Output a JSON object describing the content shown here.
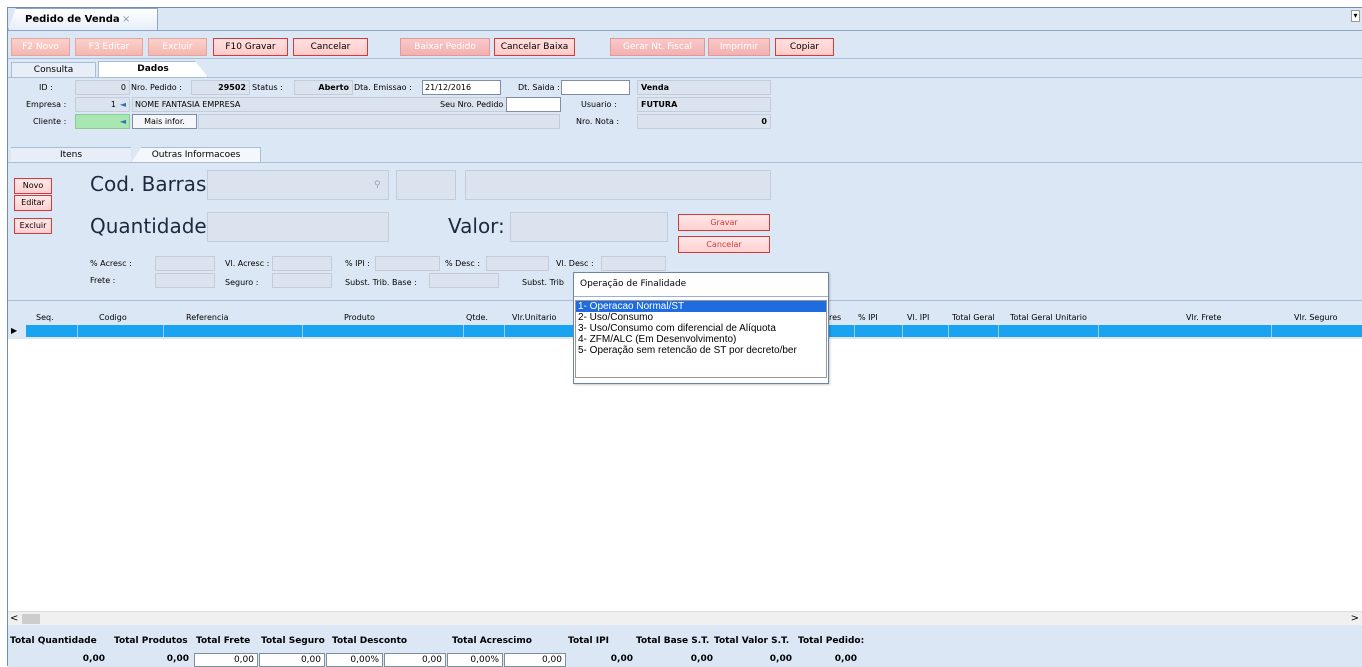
{
  "window": {
    "tab_title": "Pedido de Venda",
    "close_glyph": "×",
    "dropdown_glyph": "▾"
  },
  "toolbar": {
    "novo": "F2 Novo",
    "editar": "F3 Editar",
    "excluir": "Excluir",
    "gravar": "F10 Gravar",
    "cancelar": "Cancelar",
    "baixar": "Baixar Pedido",
    "cancelar_baixa": "Cancelar Baixa",
    "gerar_nf": "Gerar Nt. Fiscal",
    "imprimir": "Imprimir",
    "copiar": "Copiar"
  },
  "tabs": {
    "consulta": "Consulta",
    "dados": "Dados",
    "itens": "Itens",
    "outras": "Outras Informacoes"
  },
  "header": {
    "id_label": "ID :",
    "id_value": "0",
    "nro_label": "Nro. Pedido :",
    "nro_value": "29502",
    "status_label": "Status :",
    "status_value": "Aberto",
    "emissao_label": "Dta. Emissao :",
    "emissao_value": "21/12/2016",
    "saida_label": "Dt. Saida :",
    "saida_value": "",
    "tipo_value": "Venda",
    "empresa_label": "Empresa :",
    "empresa_value": "1",
    "empresa_name": "NOME FANTASIA EMPRESA",
    "seu_nro_label": "Seu Nro. Pedido :",
    "seu_nro_value": "",
    "usuario_label": "Usuario :",
    "usuario_value": "FUTURA",
    "cliente_label": "Cliente :",
    "mais_info": "Mais infor.",
    "nota_label": "Nro. Nota :",
    "nota_value": "0"
  },
  "items_form": {
    "novo": "Novo",
    "editar": "Editar",
    "excluir": "Excluir",
    "cod_barras": "Cod. Barras:",
    "quantidade": "Quantidade:",
    "valor": "Valor:",
    "gravar": "Gravar",
    "cancelar": "Cancelar",
    "acresc": "% Acresc :",
    "vl_acresc": "Vl. Acresc :",
    "ipi": "% IPI :",
    "desc": "% Desc :",
    "vl_desc": "Vl. Desc :",
    "frete": "Frete :",
    "seguro": "Seguro :",
    "subst_base": "Subst. Trib. Base :",
    "subst": "Subst. Trib"
  },
  "grid_columns": [
    "Seq.",
    "Codigo",
    "Referencia",
    "Produto",
    "Qtde.",
    "Vlr.Unitario",
    "res",
    "% IPI",
    "Vl. IPI",
    "Total Geral",
    "Total Geral Unitario",
    "Vlr. Frete",
    "Vlr. Seguro"
  ],
  "totals": {
    "labels": [
      "Total Quantidade",
      "Total Produtos",
      "Total Frete",
      "Total Seguro",
      "Total Desconto",
      "Total Acrescimo",
      "Total IPI",
      "Total Base S.T.",
      "Total Valor S.T.",
      "Total Pedido:"
    ],
    "quantidade": "0,00",
    "produtos": "0,00",
    "frete": "0,00",
    "seguro": "0,00",
    "desconto_pct": "0,00%",
    "desconto": "0,00",
    "acrescimo_pct": "0,00%",
    "acrescimo": "0,00",
    "ipi": "0,00",
    "base_st": "0,00",
    "valor_st": "0,00",
    "pedido": "0,00"
  },
  "popup": {
    "title": "Operação de Finalidade",
    "options": [
      "1- Operacao Normal/ST",
      "2- Uso/Consumo",
      "3- Uso/Consumo com diferencial de Alíquota",
      "4- ZFM/ALC (Em Desenvolvimento)",
      "5- Operação sem retencão de ST por decreto/ber"
    ]
  },
  "scroll": {
    "left": "<",
    "right": ">"
  }
}
